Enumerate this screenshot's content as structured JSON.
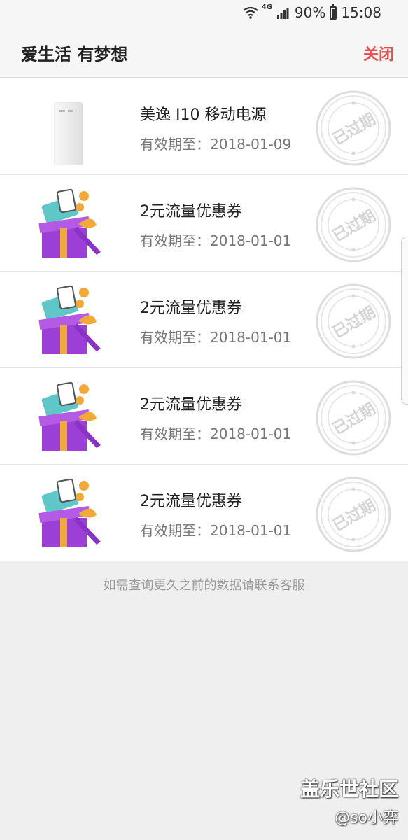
{
  "status_bar": {
    "network": "4G",
    "battery": "90%",
    "time": "15:08"
  },
  "header": {
    "title": "爱生活 有梦想",
    "close_label": "关闭"
  },
  "items": [
    {
      "name": "美逸 I10 移动电源",
      "expiry": "有效期至：2018-01-09",
      "icon": "power-bank",
      "stamp": "已过期"
    },
    {
      "name": "2元流量优惠券",
      "expiry": "有效期至：2018-01-01",
      "icon": "gift-box",
      "stamp": "已过期"
    },
    {
      "name": "2元流量优惠券",
      "expiry": "有效期至：2018-01-01",
      "icon": "gift-box",
      "stamp": "已过期"
    },
    {
      "name": "2元流量优惠券",
      "expiry": "有效期至：2018-01-01",
      "icon": "gift-box",
      "stamp": "已过期"
    },
    {
      "name": "2元流量优惠券",
      "expiry": "有效期至：2018-01-01",
      "icon": "gift-box",
      "stamp": "已过期"
    }
  ],
  "footer_note": "如需查询更久之前的数据请联系客服",
  "watermark": {
    "line1": "盖乐世社区",
    "line2": "@so小弈"
  },
  "colors": {
    "accent": "#e84b4b",
    "gift_purple": "#9c3fd6",
    "gift_ribbon": "#f2a93b",
    "ticket_teal": "#5fc7c7"
  }
}
